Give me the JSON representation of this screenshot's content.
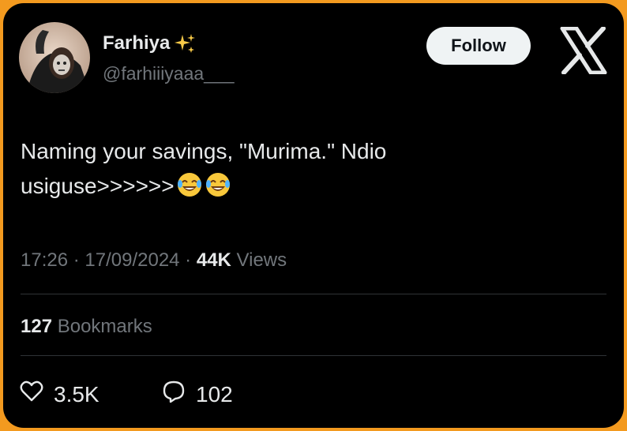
{
  "author": {
    "display_name": "Farhiya",
    "name_emoji": "sparkles-icon",
    "handle": "@farhiiiyaaa___"
  },
  "follow_label": "Follow",
  "tweet": {
    "text_line1": "Naming your savings, \"Murima.\" Ndio",
    "text_line2": "usiguse>>>>>>",
    "emojis": [
      "face-with-tears-of-joy-icon",
      "face-with-tears-of-joy-icon"
    ]
  },
  "meta": {
    "time": "17:26",
    "sep1": " · ",
    "date": "17/09/2024",
    "sep2": " · ",
    "views_count": "44K",
    "views_label": " Views"
  },
  "bookmarks": {
    "count": "127",
    "label": " Bookmarks"
  },
  "actions": {
    "likes": "3.5K",
    "replies": "102"
  },
  "colors": {
    "frame": "#f39a1f",
    "background": "#000000",
    "text": "#e7e9ea",
    "muted": "#71767b",
    "divider": "#2f3336",
    "follow_bg": "#eff3f4"
  }
}
